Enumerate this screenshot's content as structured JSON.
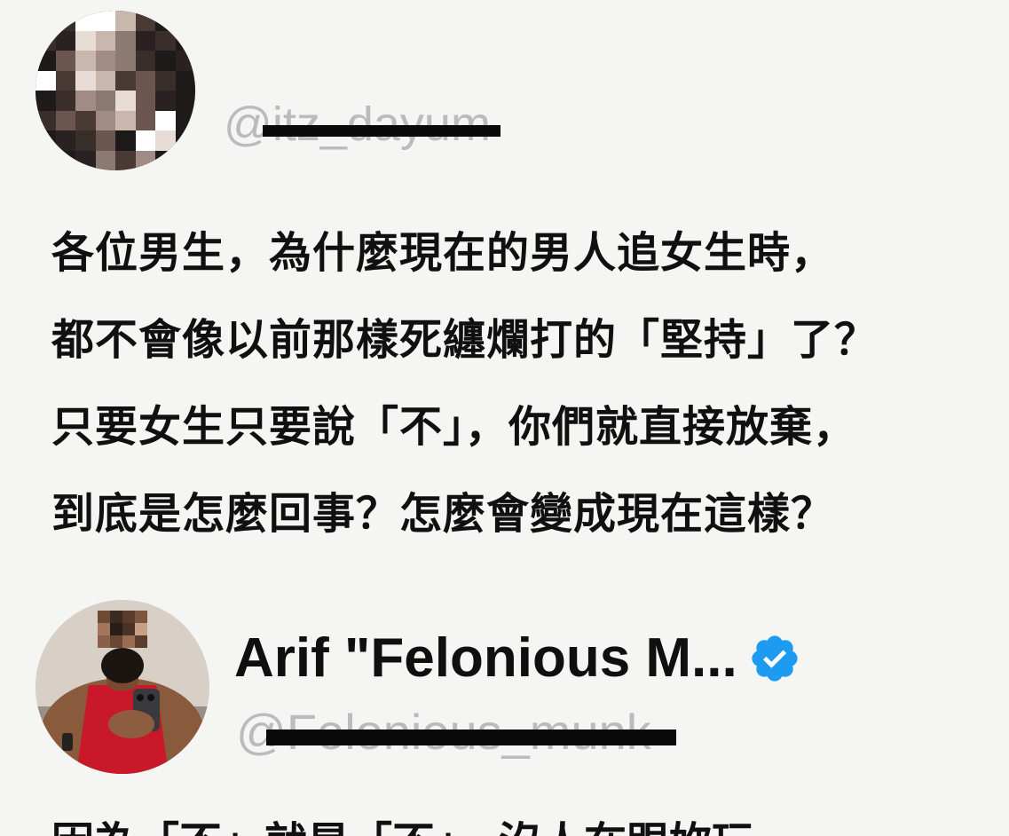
{
  "tweet1": {
    "handle": "@itz_dayum",
    "body_lines": [
      "各位男生，為什麼現在的男人追女生時，",
      "都不會像以前那樣死纏爛打的「堅持」了？",
      "只要女生只要說「不」，你們就直接放棄，",
      "到底是怎麼回事？怎麼會變成現在這樣？"
    ]
  },
  "tweet2": {
    "display_name": "Arif \"Felonious M...",
    "handle": "@Felonious_munk",
    "verified_badge_icon": "verified-check-icon",
    "verified_color": "#1d9bf0",
    "body_partial": "因為「不」就是「不」，沒人在跟妳玩"
  },
  "colors": {
    "background": "#f5f5f4",
    "handle_text": "#b9bbbd",
    "body_text": "#101010"
  }
}
